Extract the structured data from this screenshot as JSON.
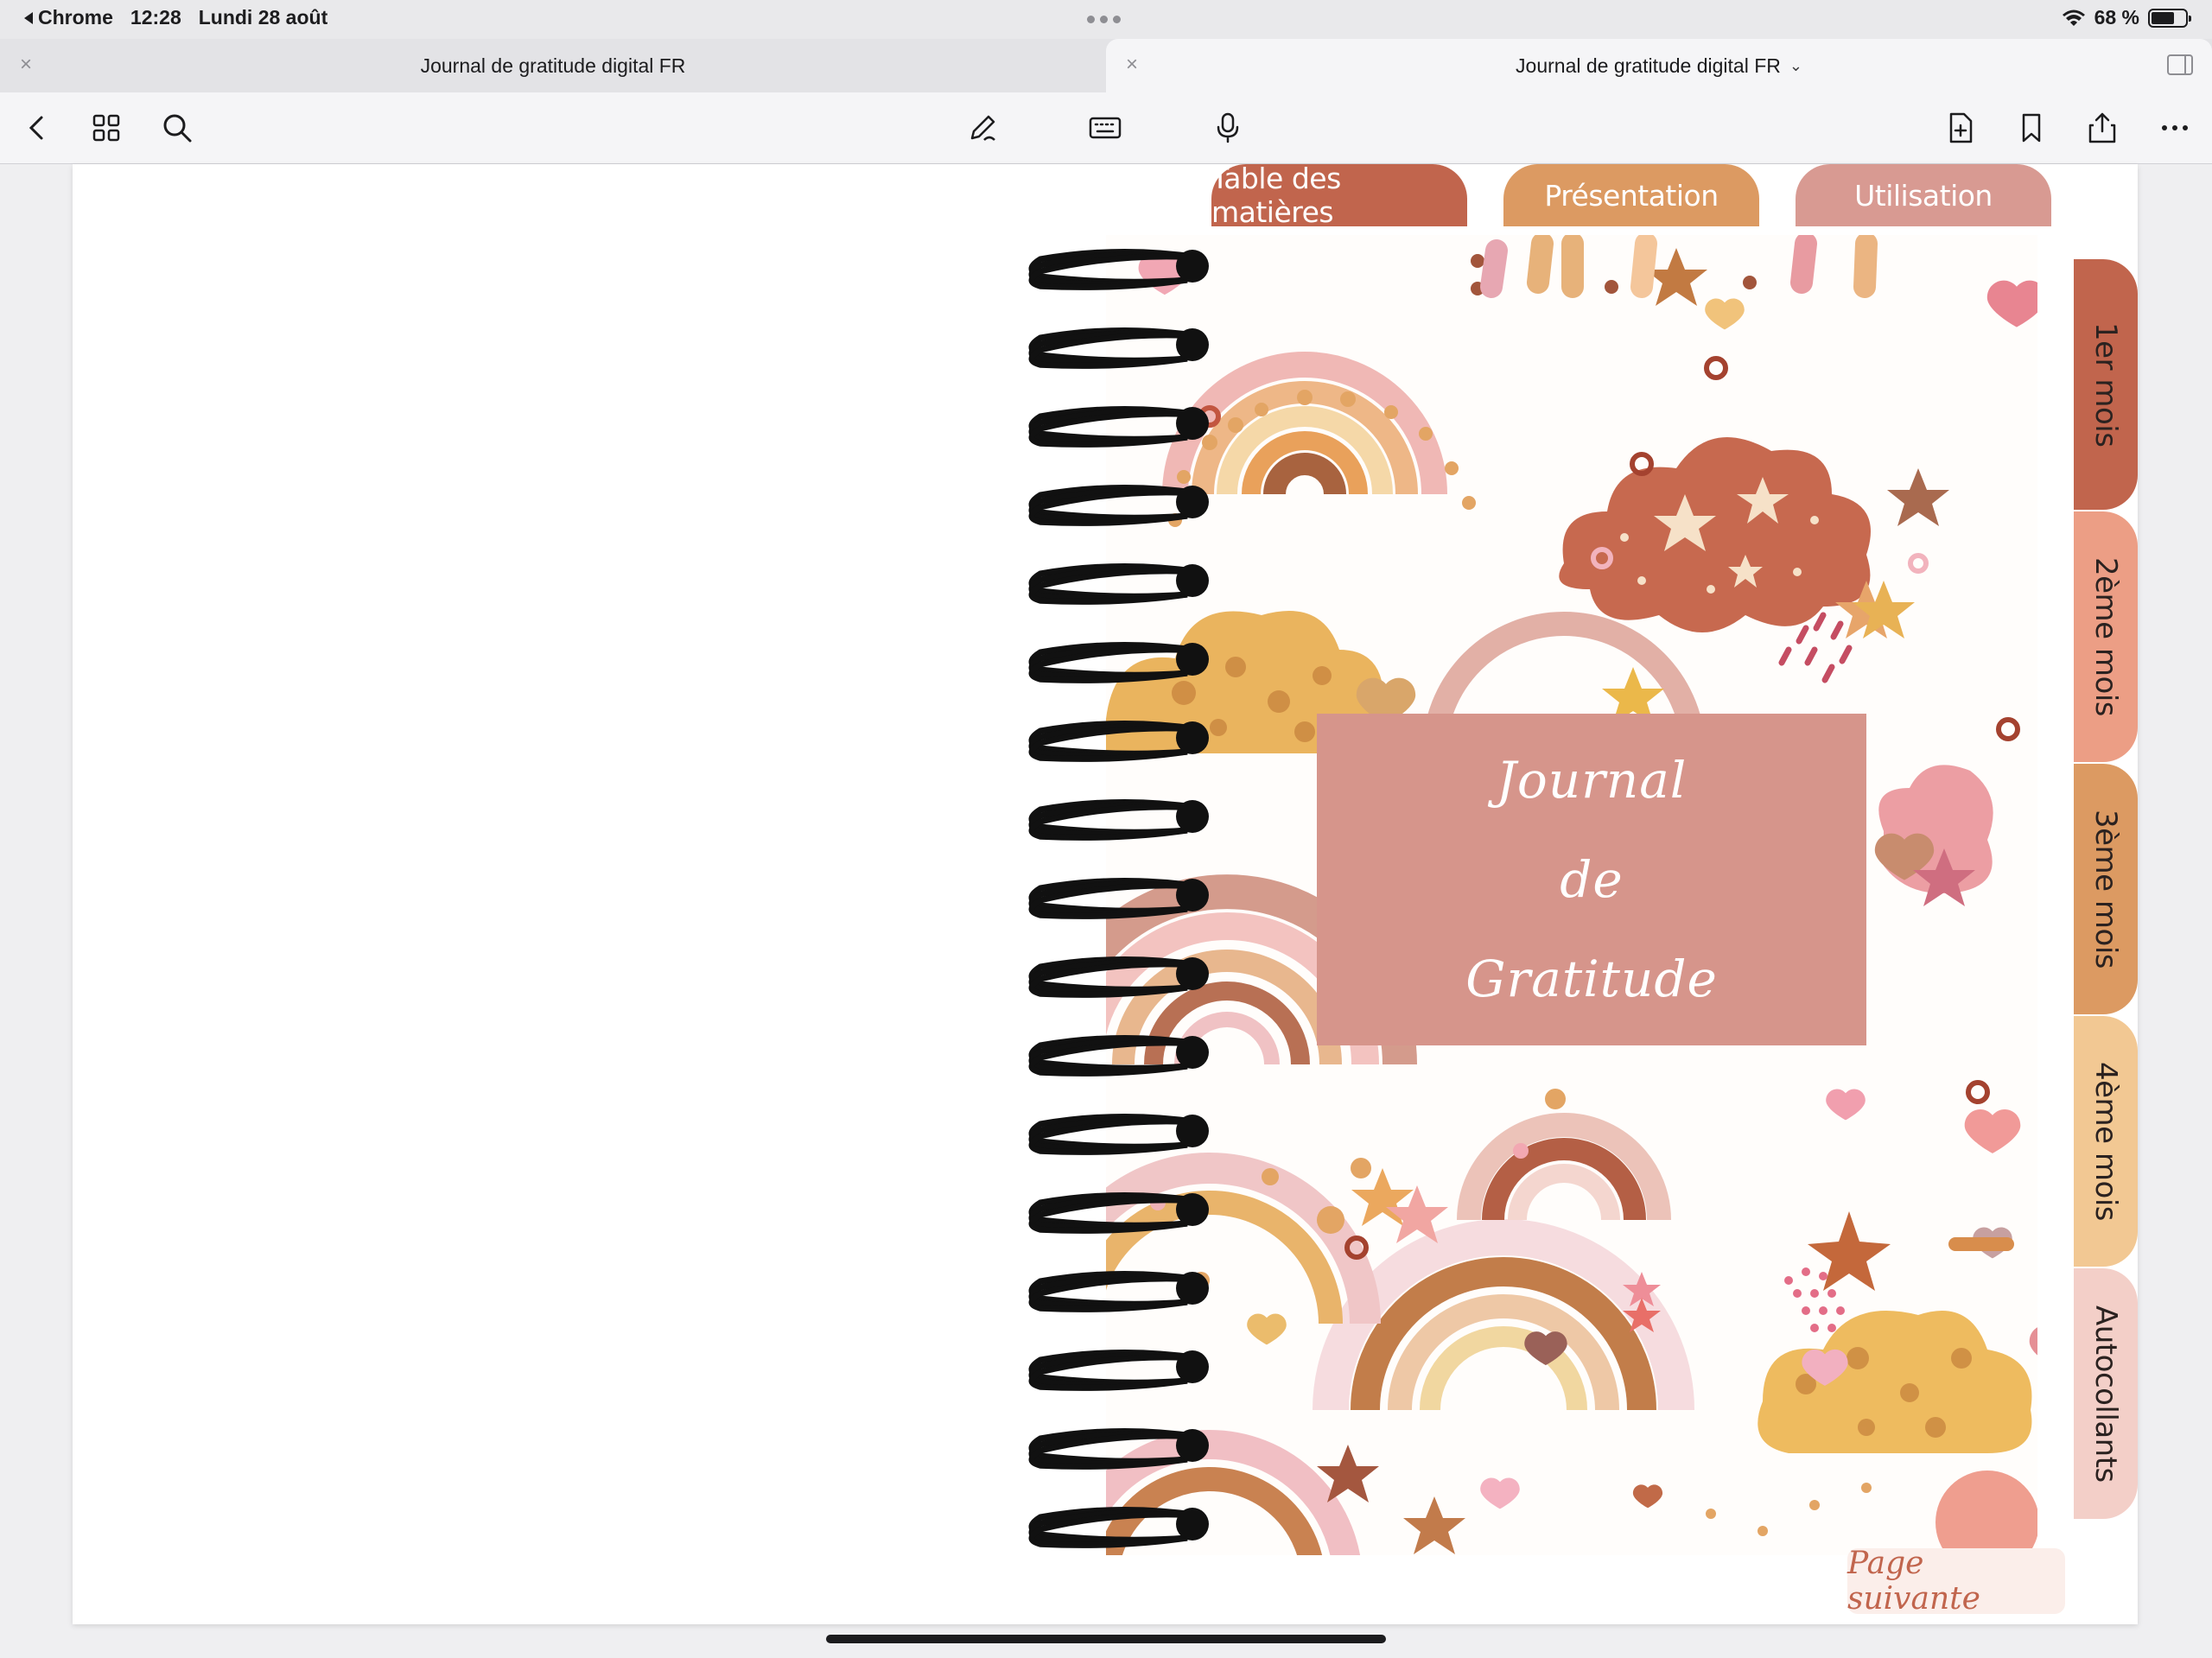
{
  "statusbar": {
    "back_app": "Chrome",
    "time": "12:28",
    "date": "Lundi 28 août",
    "battery": "68 %",
    "battery_level": 0.68
  },
  "tabs": [
    {
      "title": "Journal de gratitude digital FR",
      "active": false
    },
    {
      "title": "Journal de gratitude digital FR",
      "active": true
    }
  ],
  "toolbar": {
    "icons": [
      "back-icon",
      "grid-icon",
      "search-icon",
      "pen-icon",
      "keyboard-icon",
      "microphone-icon",
      "add-page-icon",
      "bookmark-icon",
      "share-icon",
      "more-icon"
    ]
  },
  "journal": {
    "top_tabs": [
      "Table des matières",
      "Présentation",
      "Utilisation"
    ],
    "side_tabs": [
      "1er mois",
      "2ème mois",
      "3ème mois",
      "4ème mois",
      "Autocollants"
    ],
    "title_lines": [
      "Journal",
      "de",
      "Gratitude"
    ],
    "next_page": "Page suivante",
    "colors": {
      "terracotta": "#c1654d",
      "peach": "#ec9e85",
      "ochre": "#dc9a62",
      "sand": "#f2c893",
      "blush": "#f3cfc8",
      "title_box": "#d6958b"
    }
  }
}
